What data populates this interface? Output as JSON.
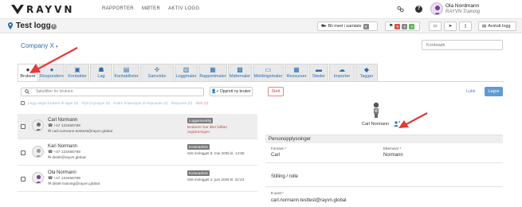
{
  "topnav": {
    "logo_text": "RAYVN",
    "links": [
      "RAPPORTER",
      "MØTER",
      "AKTIV LOGG"
    ],
    "user_name": "Ola Nordmann",
    "user_org": "RAYVN Training",
    "icons": [
      "settings-toggle-icon",
      "help-icon"
    ]
  },
  "subheader": {
    "title": "Test logg",
    "join_label": "Bli med i samtale",
    "join_count": "0",
    "counters": [
      {
        "value": "0",
        "color": "#d9534f"
      },
      {
        "value": "1",
        "color": "#8a8a8a"
      },
      {
        "value": "1",
        "color": "#5cb85c"
      }
    ],
    "end_log_label": "Avslutt logg"
  },
  "main": {
    "company": "Company X",
    "kontosok_placeholder": "Kontosøk",
    "tabs": [
      {
        "label": "Brukere",
        "icon": "user-icon",
        "active": true
      },
      {
        "label": "Respondere",
        "icon": "responder-icon",
        "active": false
      },
      {
        "label": "Kontakter",
        "icon": "contact-card-icon",
        "active": false
      },
      {
        "label": "Lag",
        "icon": "team-icon",
        "active": false
      },
      {
        "label": "Kontaktlister",
        "icon": "contact-list-icon",
        "active": false
      },
      {
        "label": "Samvirke",
        "icon": "collaboration-icon",
        "active": false
      },
      {
        "label": "Loggmaler",
        "icon": "log-template-icon",
        "active": false
      },
      {
        "label": "Rapportmaler",
        "icon": "report-template-icon",
        "active": false
      },
      {
        "label": "Møtemaler",
        "icon": "meeting-template-icon",
        "active": false
      },
      {
        "label": "Meldingsmaler",
        "icon": "message-template-icon",
        "active": false
      },
      {
        "label": "Ressurser",
        "icon": "resources-icon",
        "active": false
      },
      {
        "label": "Steder",
        "icon": "places-icon",
        "active": false
      },
      {
        "label": "Importer",
        "icon": "import-icon",
        "active": false
      },
      {
        "label": "Tagger",
        "icon": "tag-icon",
        "active": false
      }
    ]
  },
  "users_panel": {
    "search_placeholder": "Søkefilter for brukere",
    "create_user_label": "Opprett ny bruker",
    "actions": {
      "add_to_team": "Legg valgte brukere til laget (0)",
      "move_to_group": "Flytt til gruppe (0)",
      "change_to_responder": "Endre brukertype til responder (0)",
      "export": "Eksporter (0)",
      "delete": "Slett (0)"
    },
    "rows": [
      {
        "name": "Carl Normann",
        "phone": "+47 123456789",
        "email": "carl.normann.testtest@rayvn.global",
        "badge": "Loggansvarlig",
        "status": "Brukeren har ikke fullført registreringen",
        "status_error": true,
        "selected": true
      },
      {
        "name": "Kari Normann",
        "phone": "+47 123456789",
        "email": "distrk@rayvn.global",
        "badge": "Kontoadmin",
        "status": "Sist innlogget 8. mai 2025 kl. 14:55",
        "status_error": false,
        "selected": false
      },
      {
        "name": "Ola Normann",
        "phone": "+47 123456789",
        "email": "distrk-training@rayvn.global",
        "badge": "Kontoadmin",
        "status": "Sist innlogget 2. juni 2025 kl. 22:24",
        "status_error": false,
        "selected": false
      }
    ]
  },
  "detail_panel": {
    "delete_label": "Slett",
    "close_label": "Lukk",
    "save_label": "Lagre",
    "profile_name": "Carl Normann",
    "section_title": "Personopplysninger",
    "first_name_label": "Fornavn *",
    "first_name": "Carl",
    "last_name_label": "Etternavn *",
    "last_name": "Normann",
    "position_label": "Stilling / rolle",
    "email_label": "E-post *",
    "email": "carl.normann.testtest@rayvn.global"
  },
  "colors": {
    "accent": "#2a6fb0",
    "link": "#4f86bf",
    "danger": "#c34b4b",
    "primary_button": "#5f9bd4",
    "annotation_arrow": "#e53935"
  }
}
